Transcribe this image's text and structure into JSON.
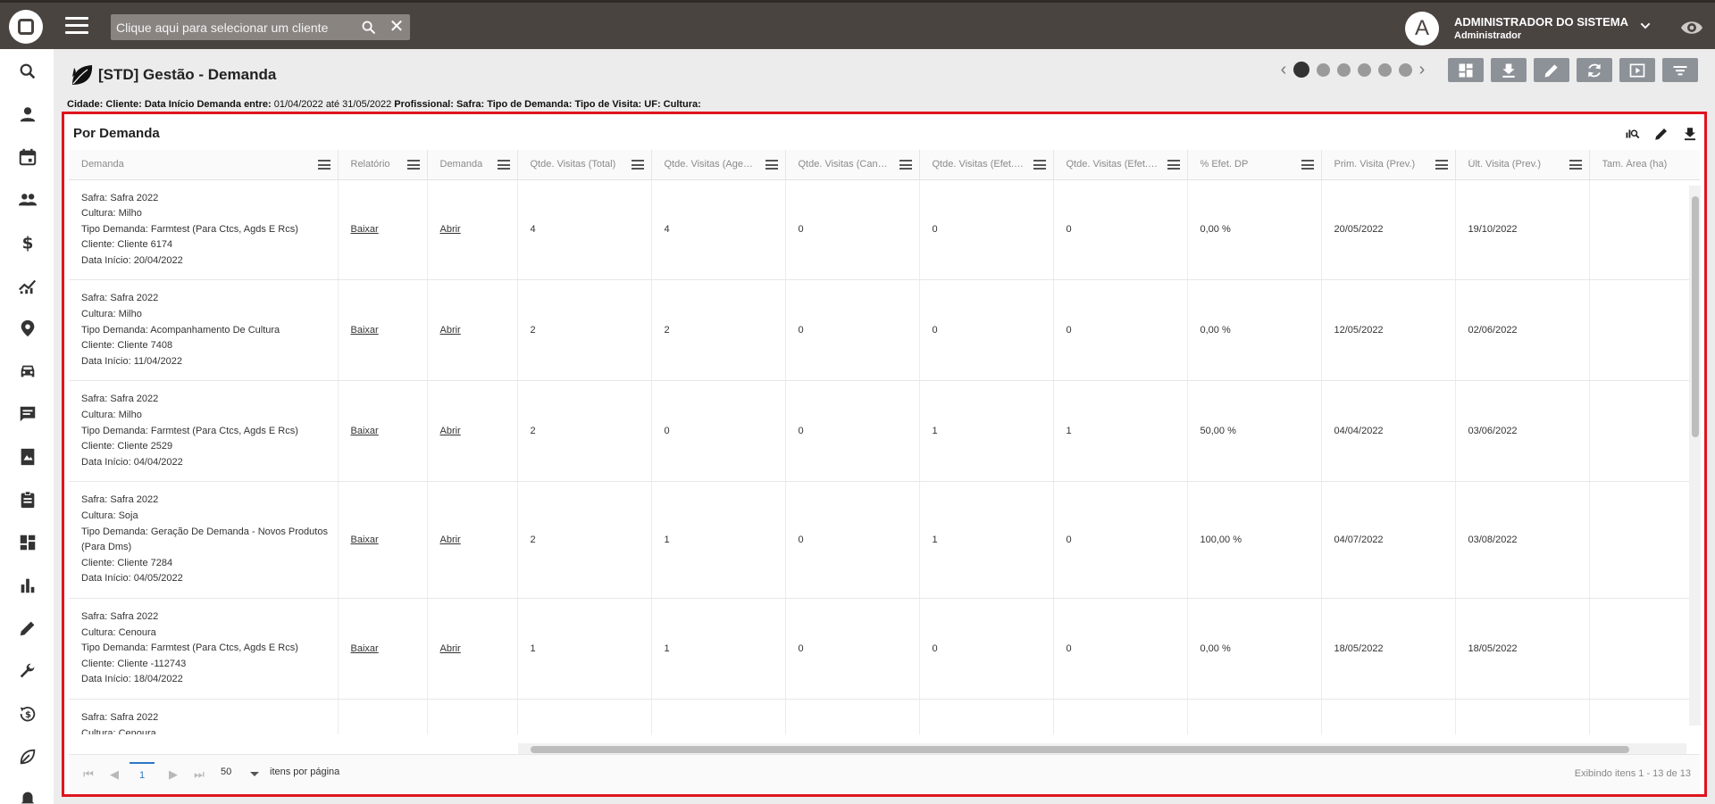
{
  "topbar": {
    "search_placeholder": "Clique aqui para selecionar um cliente",
    "avatar_letter": "A",
    "user_name": "ADMINISTRADOR DO SISTEMA",
    "user_role": "Administrador"
  },
  "sidebar": {
    "icons": [
      "search-icon",
      "person-icon",
      "calendar-icon",
      "people-icon",
      "dollar-icon",
      "trending-icon",
      "location-pin-icon",
      "car-icon",
      "message-icon",
      "image-book-icon",
      "clipboard-icon",
      "dashboard-icon",
      "bar-chart-icon",
      "pencil-icon",
      "wrench-icon",
      "history-dollar-icon",
      "leaf-icon",
      "bell-icon"
    ]
  },
  "header": {
    "title": "[STD] Gestão - Demanda",
    "filters": [
      {
        "label": "Cidade:",
        "value": ""
      },
      {
        "label": "Cliente:",
        "value": ""
      },
      {
        "label": "Data Início Demanda entre:",
        "value": "01/04/2022 até 31/05/2022"
      },
      {
        "label": "Profissional:",
        "value": ""
      },
      {
        "label": "Safra:",
        "value": ""
      },
      {
        "label": "Tipo de Demanda:",
        "value": ""
      },
      {
        "label": "Tipo de Visita:",
        "value": ""
      },
      {
        "label": "UF:",
        "value": ""
      },
      {
        "label": "Cultura:",
        "value": ""
      }
    ],
    "page_dots": 6,
    "active_dot": 0
  },
  "panel": {
    "title": "Por Demanda",
    "columns": [
      "Demanda",
      "Relatório",
      "Demanda",
      "Qtde. Visitas (Total)",
      "Qtde. Visitas (Agendadas)",
      "Qtde. Visitas (Canceladas)",
      "Qtde. Visitas (Efet. DP)",
      "Qtde. Visitas (Efet. Fora DP)",
      "% Efet. DP",
      "Prim. Visita (Prev.)",
      "Últ. Visita (Prev.)",
      "Tam. Área (ha)"
    ],
    "rows": [
      {
        "demanda": [
          "Safra: Safra 2022",
          "Cultura: Milho",
          "Tipo Demanda: Farmtest (Para Ctcs, Agds E Rcs)",
          "Cliente: Cliente 6174",
          "Data Início: 20/04/2022"
        ],
        "relatorio": "Baixar",
        "abrir": "Abrir",
        "total": "4",
        "agend": "4",
        "cancel": "0",
        "efet_dp": "0",
        "efet_fora": "0",
        "pct": "0,00 %",
        "prim": "20/05/2022",
        "ult": "19/10/2022",
        "area": ""
      },
      {
        "demanda": [
          "Safra: Safra 2022",
          "Cultura: Milho",
          "Tipo Demanda: Acompanhamento De Cultura",
          "Cliente: Cliente 7408",
          "Data Início: 11/04/2022"
        ],
        "relatorio": "Baixar",
        "abrir": "Abrir",
        "total": "2",
        "agend": "2",
        "cancel": "0",
        "efet_dp": "0",
        "efet_fora": "0",
        "pct": "0,00 %",
        "prim": "12/05/2022",
        "ult": "02/06/2022",
        "area": ""
      },
      {
        "demanda": [
          "Safra: Safra 2022",
          "Cultura: Milho",
          "Tipo Demanda: Farmtest (Para Ctcs, Agds E Rcs)",
          "Cliente: Cliente 2529",
          "Data Início: 04/04/2022"
        ],
        "relatorio": "Baixar",
        "abrir": "Abrir",
        "total": "2",
        "agend": "0",
        "cancel": "0",
        "efet_dp": "1",
        "efet_fora": "1",
        "pct": "50,00 %",
        "prim": "04/04/2022",
        "ult": "03/06/2022",
        "area": ""
      },
      {
        "demanda": [
          "Safra: Safra 2022",
          "Cultura: Soja",
          "Tipo Demanda: Geração De Demanda - Novos Produtos",
          "(Para Dms)",
          "Cliente: Cliente 7284",
          "Data Início: 04/05/2022"
        ],
        "relatorio": "Baixar",
        "abrir": "Abrir",
        "total": "2",
        "agend": "1",
        "cancel": "0",
        "efet_dp": "1",
        "efet_fora": "0",
        "pct": "100,00 %",
        "prim": "04/07/2022",
        "ult": "03/08/2022",
        "area": ""
      },
      {
        "demanda": [
          "Safra: Safra 2022",
          "Cultura: Cenoura",
          "Tipo Demanda: Farmtest (Para Ctcs, Agds E Rcs)",
          "Cliente: Cliente -112743",
          "Data Início: 18/04/2022"
        ],
        "relatorio": "Baixar",
        "abrir": "Abrir",
        "total": "1",
        "agend": "1",
        "cancel": "0",
        "efet_dp": "0",
        "efet_fora": "0",
        "pct": "0,00 %",
        "prim": "18/05/2022",
        "ult": "18/05/2022",
        "area": ""
      },
      {
        "demanda": [
          "Safra: Safra 2022",
          "Cultura: Cenoura"
        ],
        "relatorio": "",
        "abrir": "",
        "total": "",
        "agend": "",
        "cancel": "",
        "efet_dp": "",
        "efet_fora": "",
        "pct": "",
        "prim": "",
        "ult": "",
        "area": ""
      }
    ],
    "pager": {
      "current_page": "1",
      "page_size": "50",
      "page_size_label": "itens por página",
      "info": "Exibindo itens 1 - 13 de 13"
    }
  },
  "colors": {
    "topbar": "#4a4441",
    "highlight_border": "#e0141e",
    "tool_button": "#8d9299",
    "active_page": "#2c78c7"
  }
}
